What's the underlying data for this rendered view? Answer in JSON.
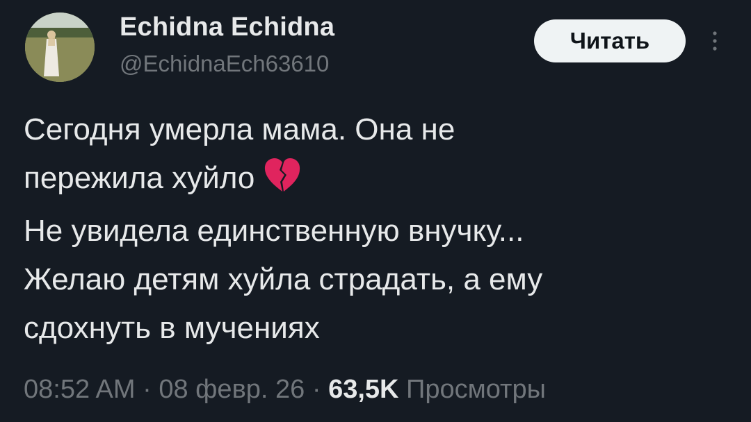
{
  "author": {
    "display_name": "Echidna Echidna",
    "handle": "@EchidnaEch63610",
    "avatar": "profile-photo"
  },
  "follow_button": {
    "label": "Читать"
  },
  "more_button": {
    "icon": "more-vertical-icon"
  },
  "tweet": {
    "lines": [
      "Сегодня умерла мама. Она не",
      "пережила хуйло",
      "Не увидела единственную внучку...",
      "Желаю детям хуйла страдать, а ему",
      "сдохнуть в мучениях"
    ],
    "emoji": "broken-heart-icon"
  },
  "meta": {
    "time": "08:52 AM",
    "separator": "·",
    "date": "08 февр. 26",
    "views_count": "63,5K",
    "views_label": "Просмотры"
  },
  "colors": {
    "background": "#151b23",
    "primary_text": "#e7e9ea",
    "secondary_text": "#71767b",
    "button_bg": "#eff3f4",
    "emoji": "#e0245e"
  }
}
